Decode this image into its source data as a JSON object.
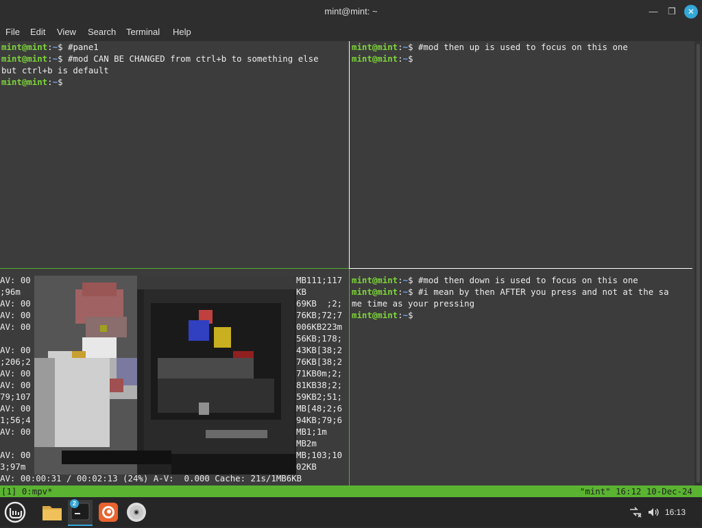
{
  "window": {
    "title": "mint@mint: ~"
  },
  "menu": {
    "items": [
      "File",
      "Edit",
      "View",
      "Search",
      "Terminal",
      "Help"
    ]
  },
  "prompt": {
    "user_host": "mint@mint",
    "sep": ":",
    "path": "~",
    "sigil": "$ "
  },
  "panes": {
    "top_left": {
      "lines": [
        {
          "prompt": true,
          "cmd": "#pane1"
        },
        {
          "prompt": true,
          "cmd": "#mod CAN BE CHANGED from ctrl+b to something else"
        },
        {
          "prompt": false,
          "text": "but ctrl+b is default"
        },
        {
          "prompt": true,
          "cmd": ""
        }
      ]
    },
    "top_right": {
      "lines": [
        {
          "prompt": true,
          "cmd": "#mod then up is used to focus on this one"
        },
        {
          "prompt": true,
          "cmd": ""
        }
      ]
    },
    "bottom_right": {
      "lines": [
        {
          "prompt": true,
          "cmd": "#mod then down is used to focus on this one"
        },
        {
          "prompt": true,
          "cmd": "#i mean by then AFTER you press and not at the sa"
        },
        {
          "prompt": false,
          "text": "me time as your pressing"
        },
        {
          "prompt": true,
          "cmd": ""
        }
      ]
    },
    "mpv": {
      "left_fragments": [
        "AV: 00",
        ";96m",
        "AV: 00",
        "AV: 00",
        "AV: 00",
        "",
        "AV: 00",
        ";206;2",
        "AV: 00",
        "AV: 00",
        "79;107",
        "AV: 00",
        "1;56;4",
        "AV: 00",
        "",
        "AV: 00",
        "3;97m"
      ],
      "right_fragments": [
        "MB111;117",
        "KB",
        "69KB  ;2;",
        "76KB;72;7",
        "006KB223m",
        "56KB;178;",
        "43KB[38;2",
        "76KB[38;2",
        "71KB0m;2;",
        "81KB38;2;",
        "59KB2;51;",
        "MB[48;2;6",
        "94KB;79;6",
        "MB1;1m",
        "MB2m",
        "MB;103;10",
        "02KB"
      ],
      "status": "AV: 00:00:31 / 00:02:13 (24%) A-V:  0.000 Cache: 21s/1MB6KB"
    }
  },
  "tmux": {
    "left": "[1] 0:mpv*",
    "right": "\"mint\" 16:12 10-Dec-24"
  },
  "taskbar": {
    "terminal_badge": "2",
    "clock": "16:13"
  },
  "colors": {
    "prompt_user": "#7cd33a",
    "prompt_path": "#6fa3f0",
    "tmux_bar": "#5ab331",
    "accent": "#35a6d8"
  }
}
